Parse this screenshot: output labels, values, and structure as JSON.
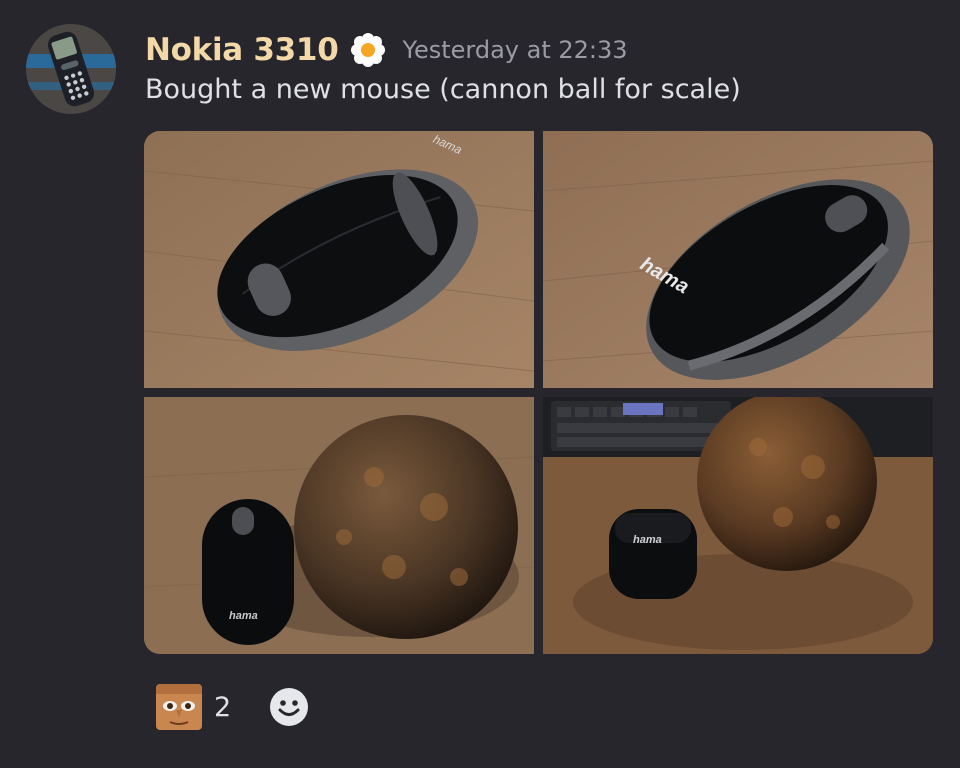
{
  "message": {
    "author": "Nokia 3310",
    "timestamp": "Yesterday at 22:33",
    "content": "Bought a new mouse (cannon ball for scale)",
    "author_color": "#f4d9a8",
    "avatar_icon": "nokia-phone-icon",
    "badge_icon": "flower-badge-icon"
  },
  "attachments": [
    {
      "name": "mouse-top-view",
      "brand_text": "hama"
    },
    {
      "name": "mouse-side-view",
      "brand_text": "hama"
    },
    {
      "name": "mouse-next-to-cannonball-top",
      "brand_text": "hama"
    },
    {
      "name": "mouse-next-to-cannonball-desk",
      "brand_text": "hama"
    }
  ],
  "reactions": [
    {
      "emoji_icon": "face-emoji-icon",
      "count": "2"
    }
  ],
  "add_reaction_icon": "smiley-add-reaction-icon",
  "colors": {
    "background": "#26262c",
    "text": "#dfe0e4",
    "muted": "#9a9ba4"
  }
}
